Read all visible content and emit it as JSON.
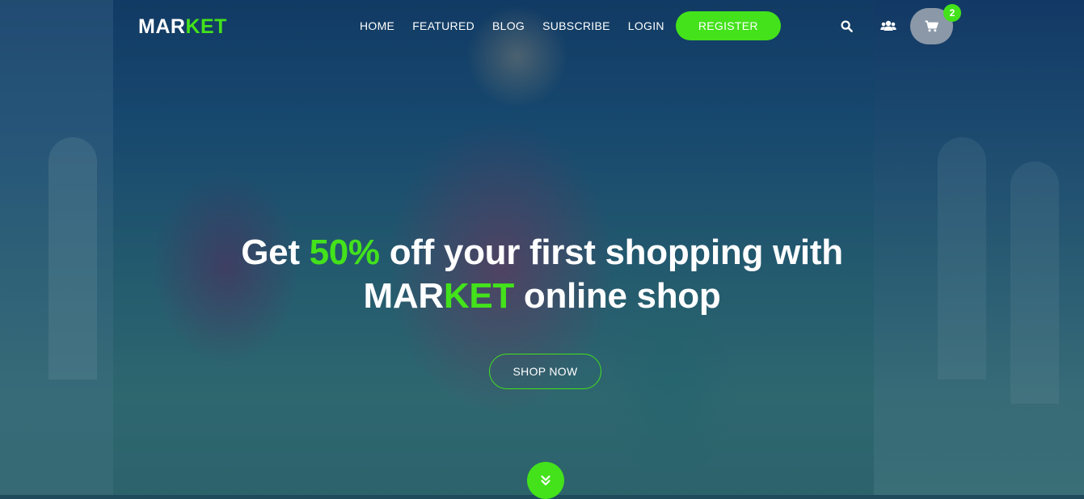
{
  "logo": {
    "part1": "MAR",
    "part2": "KET"
  },
  "nav": {
    "links": [
      {
        "label": "HOME"
      },
      {
        "label": "FEATURED"
      },
      {
        "label": "BLOG"
      },
      {
        "label": "SUBSCRIBE"
      },
      {
        "label": "LOGIN"
      }
    ],
    "register_label": "REGISTER",
    "search_icon": "search-icon",
    "users_icon": "users-icon",
    "cart_icon": "cart-icon",
    "cart_count": "2"
  },
  "hero": {
    "line1_before": "Get ",
    "line1_highlight": "50%",
    "line1_after": " off your first shopping with",
    "line2_brand1": "MAR",
    "line2_brand2": "KET",
    "line2_after": " online shop",
    "cta_label": "SHOP NOW",
    "scroll_icon": "chevron-double-down-icon"
  },
  "colors": {
    "accent": "#43e21b",
    "cart_button": "#8b98a8",
    "text": "#ffffff"
  }
}
